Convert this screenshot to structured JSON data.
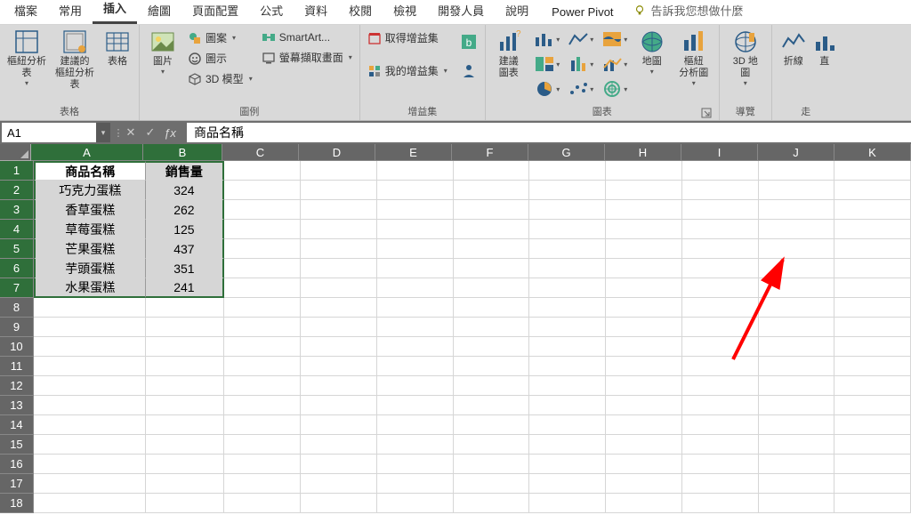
{
  "tabs": {
    "file": "檔案",
    "home": "常用",
    "insert": "插入",
    "draw": "繪圖",
    "layout": "頁面配置",
    "formulas": "公式",
    "data": "資料",
    "review": "校閱",
    "view": "檢視",
    "developer": "開發人員",
    "help": "說明",
    "powerpivot": "Power Pivot",
    "tellme": "告訴我您想做什麼"
  },
  "ribbon": {
    "groups": {
      "tables": "表格",
      "illustrations": "圖例",
      "addins": "增益集",
      "charts": "圖表",
      "tours": "導覽",
      "sparklines": "走"
    },
    "btn": {
      "pivot_table": "樞紐分析表",
      "recommended_pivot": "建議的\n樞紐分析表",
      "table": "表格",
      "pictures": "圖片",
      "shapes": "圖案",
      "icons": "圖示",
      "models3d": "3D 模型",
      "smartart": "SmartArt...",
      "screenshot": "螢幕擷取畫面",
      "get_addins": "取得增益集",
      "my_addins": "我的增益集",
      "bing": "",
      "people": "",
      "recommended_charts": "建議\n圖表",
      "maps": "地圖",
      "pivot_chart": "樞紐\n分析圖",
      "map3d": "3D 地\n圖",
      "sparkline_line": "折線",
      "sparkline_col": "直"
    }
  },
  "namebox": "A1",
  "formula": "商品名稱",
  "columns": [
    "A",
    "B",
    "C",
    "D",
    "E",
    "F",
    "G",
    "H",
    "I",
    "J",
    "K"
  ],
  "chart_data": {
    "type": "table",
    "headers": [
      "商品名稱",
      "銷售量"
    ],
    "rows": [
      [
        "巧克力蛋糕",
        324
      ],
      [
        "香草蛋糕",
        262
      ],
      [
        "草莓蛋糕",
        125
      ],
      [
        "芒果蛋糕",
        437
      ],
      [
        "芋頭蛋糕",
        351
      ],
      [
        "水果蛋糕",
        241
      ]
    ]
  },
  "row_count": 18
}
